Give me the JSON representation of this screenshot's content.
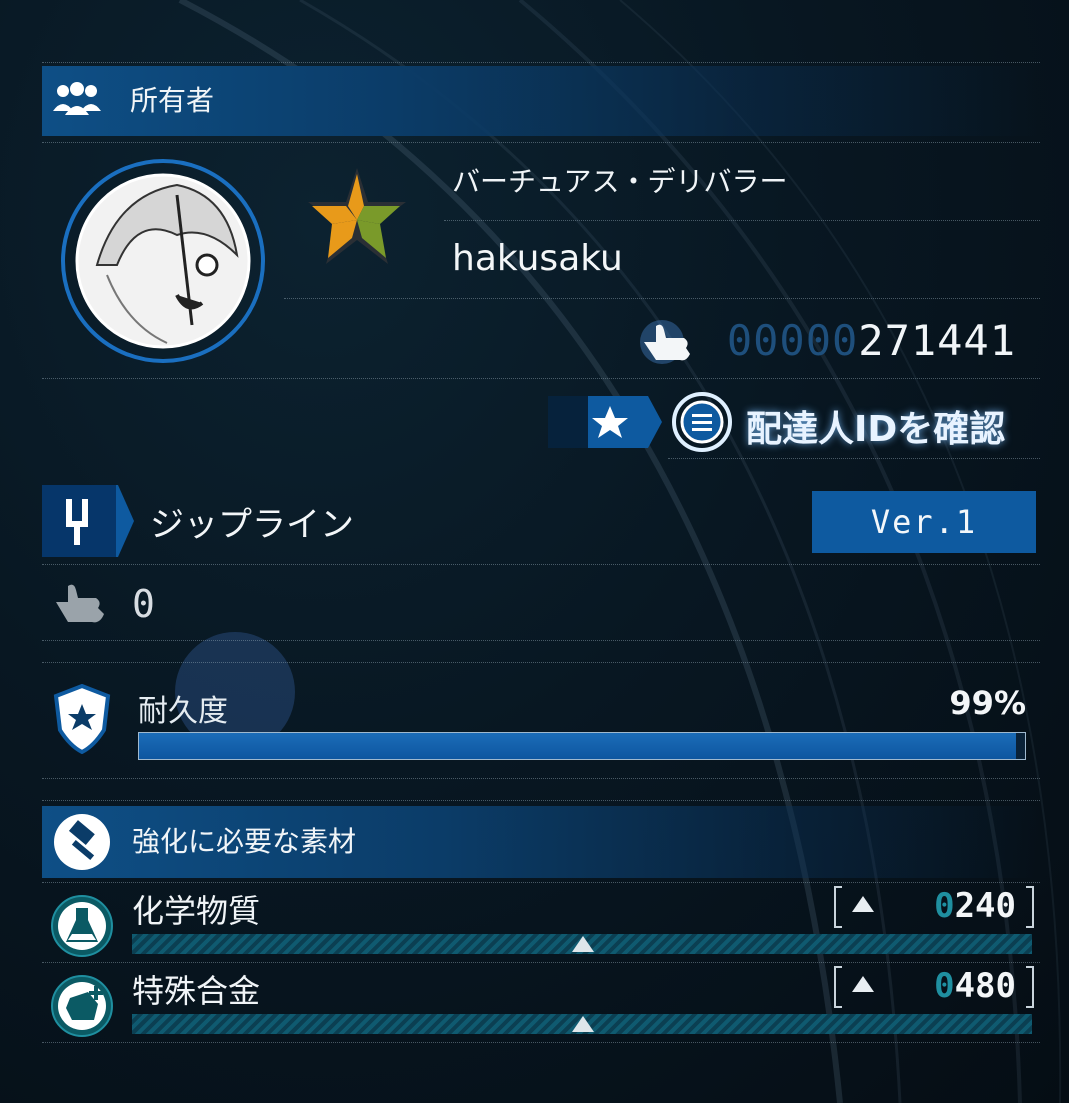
{
  "owner_section": {
    "header_label": "所有者",
    "icon": "people-icon"
  },
  "profile": {
    "title": "バーチュアス・デリバラー",
    "name": "hakusaku",
    "rank_icon": "star-rank-icon",
    "likes_leading_zeros": "00000",
    "likes_value": "271441",
    "likes_icon": "thumbs-up-icon"
  },
  "porter_id_button": {
    "label": "配達人IDを確認",
    "icon_left": "star-badge-icon",
    "icon_right": "menu-circle-icon"
  },
  "structure": {
    "name": "ジップライン",
    "icon": "zipline-icon",
    "version": "Ver.1",
    "likes_count": "0",
    "likes_icon": "thumbs-up-gray-icon"
  },
  "durability": {
    "label": "耐久度",
    "percent_text": "99%",
    "percent_value": 0.99,
    "icon": "shield-icon"
  },
  "materials_section": {
    "header_label": "強化に必要な素材",
    "icon": "hammer-icon",
    "items": [
      {
        "name": "化学物質",
        "amount_lead": "0",
        "amount": "240",
        "icon": "flask-icon"
      },
      {
        "name": "特殊合金",
        "amount_lead": "0",
        "amount": "480",
        "icon": "alloy-icon"
      }
    ]
  },
  "colors": {
    "accent_blue": "#0e5aa0",
    "teal": "#1f8fa0",
    "orange": "#e89a1a",
    "olive": "#7a9a2a"
  }
}
